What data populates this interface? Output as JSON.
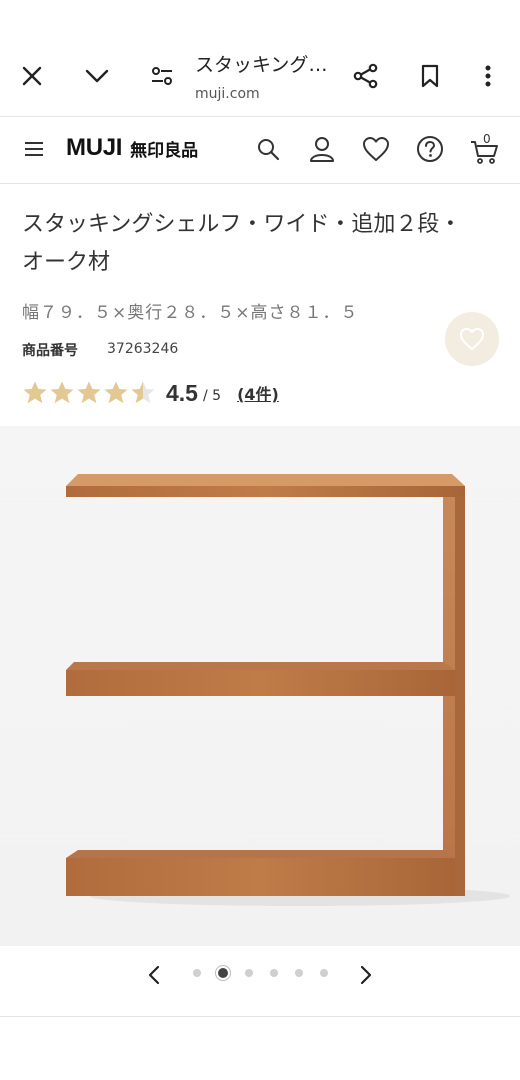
{
  "browser": {
    "page_title": "スタッキングシェルフ・ワイド・追加２段・オーク材",
    "domain": "muji.com",
    "icons": [
      "close-icon",
      "chevron-down-icon",
      "tune-icon",
      "share-icon",
      "bookmark-icon",
      "more-icon"
    ]
  },
  "header": {
    "logo_en": "MUJI",
    "logo_jp": "無印良品",
    "cart_count": "0",
    "icons": [
      "menu-icon",
      "search-icon",
      "account-icon",
      "heart-icon",
      "help-icon",
      "cart-icon"
    ]
  },
  "product": {
    "title": "スタッキングシェルフ・ワイド・追加２段・オーク材",
    "dimensions": "幅７９．５×奥行２８．５×高さ８１．５",
    "number_label": "商品番号",
    "number_value": "37263246",
    "rating": 4.5,
    "rating_display": "4.5",
    "rating_max": "/ 5",
    "review_count": "(4件)"
  },
  "carousel": {
    "total": 6,
    "active_index": 1
  },
  "colors": {
    "star": "#e3c893",
    "star_empty": "#e6e6e6",
    "fav_bg": "#f3ece0",
    "wood_top": "#c98b55",
    "wood_front": "#b87444"
  }
}
